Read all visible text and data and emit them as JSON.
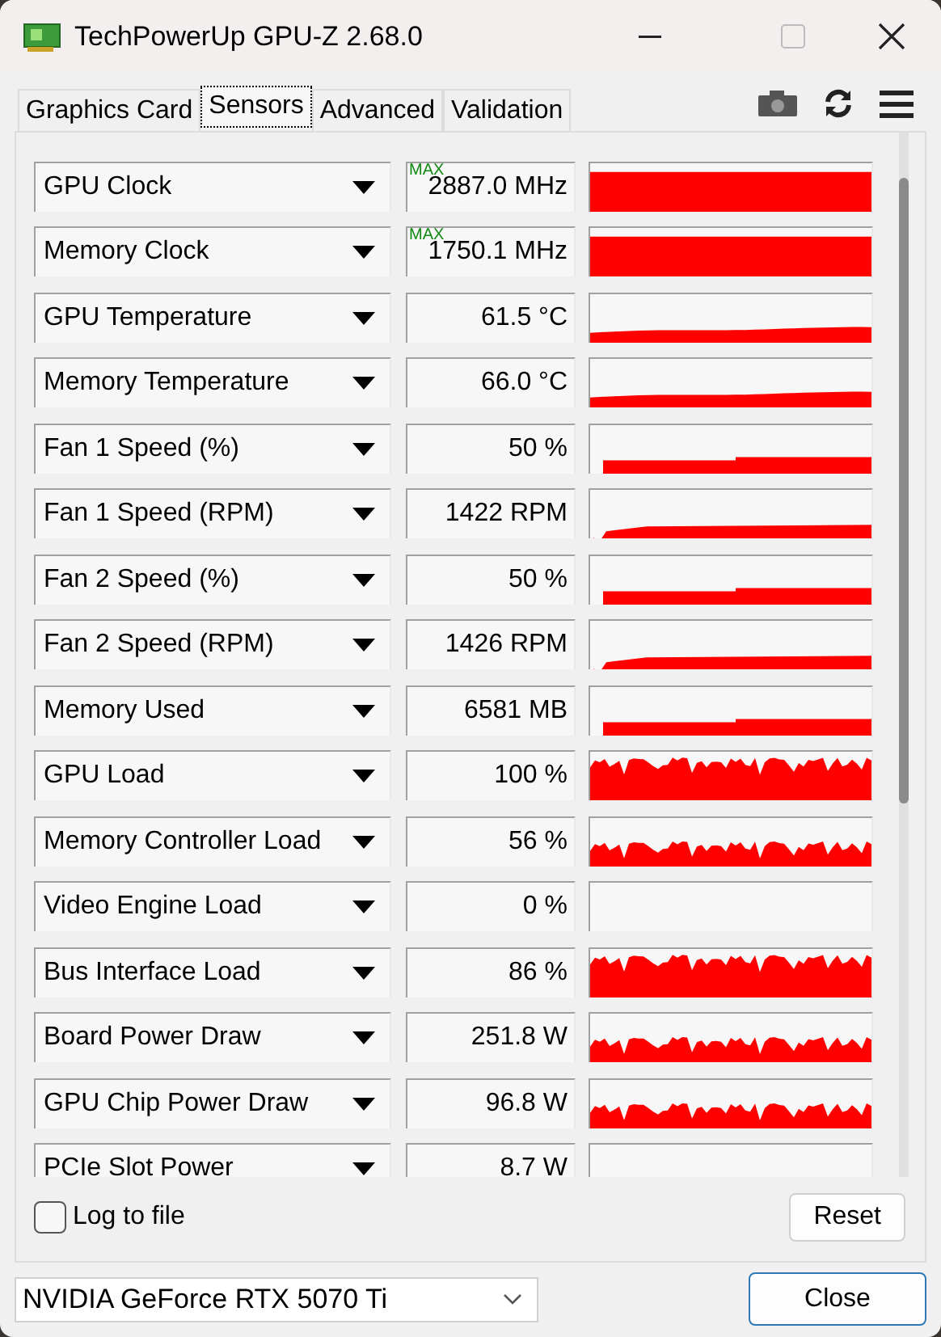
{
  "window": {
    "title": "TechPowerUp GPU-Z 2.68.0"
  },
  "tabs": [
    {
      "label": "Graphics Card",
      "selected": false
    },
    {
      "label": "Sensors",
      "selected": true
    },
    {
      "label": "Advanced",
      "selected": false
    },
    {
      "label": "Validation",
      "selected": false
    }
  ],
  "sensors": [
    {
      "name": "GPU Clock",
      "tag": "MAX",
      "value": "2887.0 MHz",
      "kind": "full"
    },
    {
      "name": "Memory Clock",
      "tag": "MAX",
      "value": "1750.1 MHz",
      "kind": "full"
    },
    {
      "name": "GPU Temperature",
      "value": "61.5 °C",
      "kind": "ramp"
    },
    {
      "name": "Memory Temperature",
      "value": "66.0 °C",
      "kind": "ramp"
    },
    {
      "name": "Fan 1 Speed (%)",
      "value": "50 %",
      "kind": "step"
    },
    {
      "name": "Fan 1 Speed (RPM)",
      "value": "1422 RPM",
      "kind": "notch"
    },
    {
      "name": "Fan 2 Speed (%)",
      "value": "50 %",
      "kind": "step"
    },
    {
      "name": "Fan 2 Speed (RPM)",
      "value": "1426 RPM",
      "kind": "notch"
    },
    {
      "name": "Memory Used",
      "value": "6581 MB",
      "kind": "step"
    },
    {
      "name": "GPU Load",
      "value": "100 %",
      "kind": "busy"
    },
    {
      "name": "Memory Controller Load",
      "value": "56 %",
      "kind": "noisy"
    },
    {
      "name": "Video Engine Load",
      "value": "0 %",
      "kind": "empty"
    },
    {
      "name": "Bus Interface Load",
      "value": "86 %",
      "kind": "busy"
    },
    {
      "name": "Board Power Draw",
      "value": "251.8 W",
      "kind": "noisy"
    },
    {
      "name": "GPU Chip Power Draw",
      "value": "96.8 W",
      "kind": "noisy"
    },
    {
      "name": "PCIe Slot Power",
      "value": "8.7 W",
      "kind": "empty"
    }
  ],
  "log_to_file": {
    "label": "Log to file",
    "checked": false
  },
  "reset_button": "Reset",
  "device": {
    "value": "NVIDIA GeForce RTX 5070 Ti"
  },
  "close_button": "Close"
}
